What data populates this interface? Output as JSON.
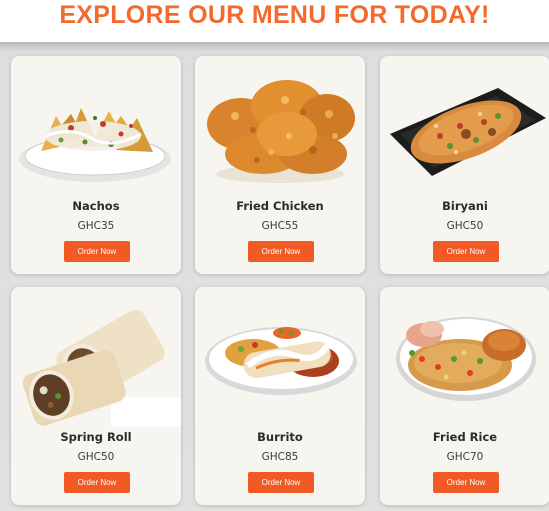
{
  "page": {
    "title": "EXPLORE OUR MENU FOR TODAY!",
    "accent_color": "#f26a2e",
    "button_color": "#f15a24"
  },
  "menu": {
    "items": [
      {
        "name": "Nachos",
        "price": "GHC35",
        "button_label": "Order Now",
        "image": "nachos-image"
      },
      {
        "name": "Fried Chicken",
        "price": "GHC55",
        "button_label": "Order Now",
        "image": "fried-chicken-image"
      },
      {
        "name": "Biryani",
        "price": "GHC50",
        "button_label": "Order Now",
        "image": "biryani-image"
      },
      {
        "name": "Spring Roll",
        "price": "GHC50",
        "button_label": "Order Now",
        "image": "spring-roll-image"
      },
      {
        "name": "Burrito",
        "price": "GHC85",
        "button_label": "Order Now",
        "image": "burrito-image"
      },
      {
        "name": "Fried Rice",
        "price": "GHC70",
        "button_label": "Order Now",
        "image": "fried-rice-image"
      }
    ]
  }
}
